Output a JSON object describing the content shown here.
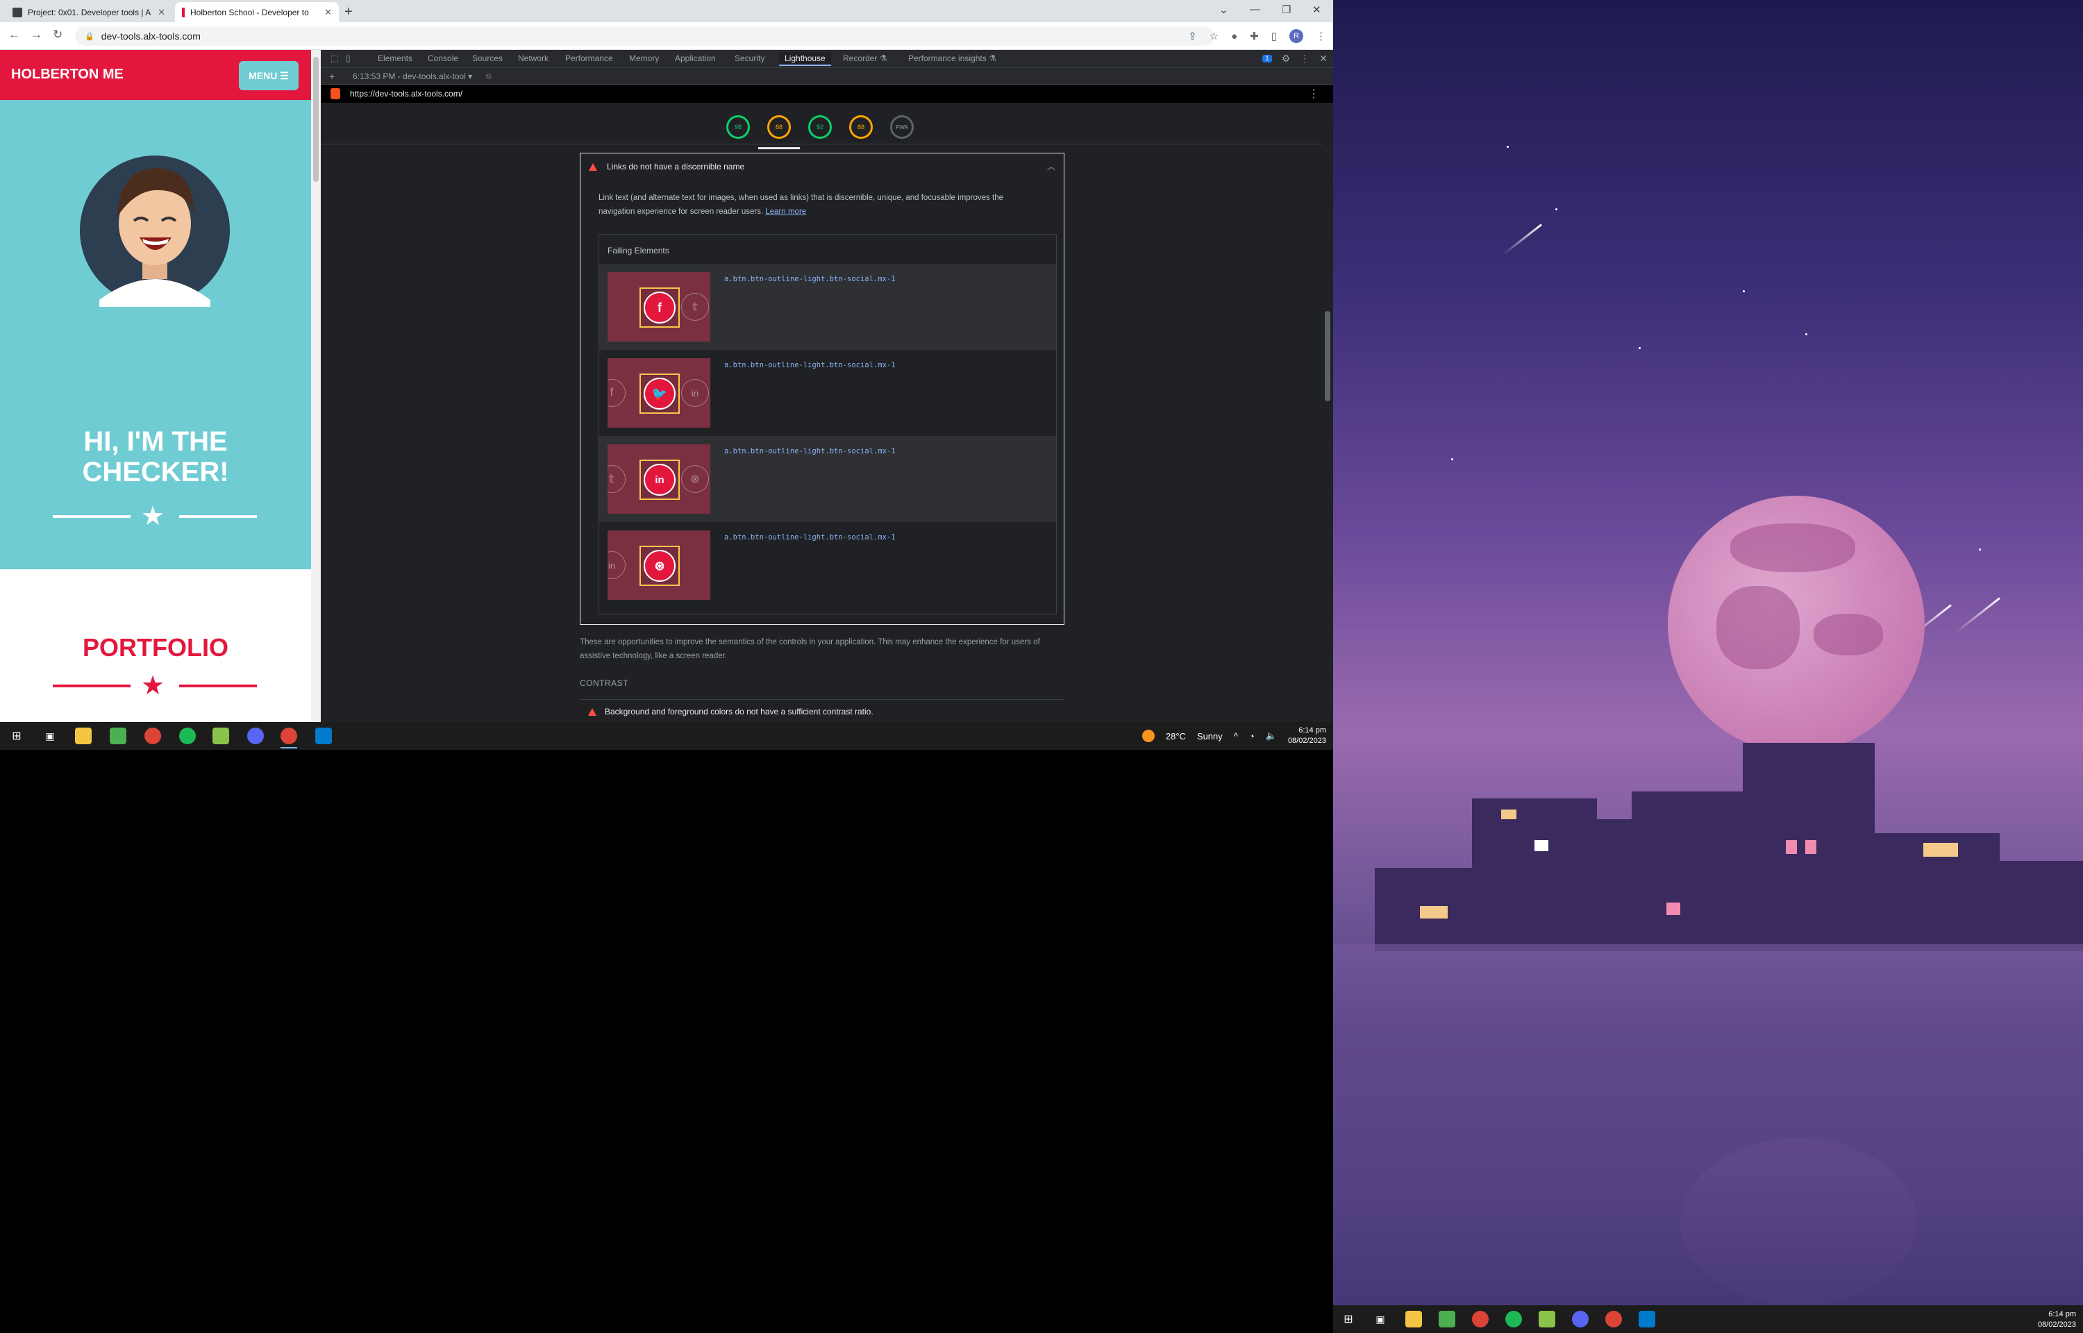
{
  "browser": {
    "tabs": [
      {
        "title": "Project: 0x01. Developer tools | A"
      },
      {
        "title": "Holberton School - Developer to"
      }
    ],
    "url": "dev-tools.alx-tools.com",
    "profile_initial": "R"
  },
  "site": {
    "logo": "HOLBERTON ME",
    "menu_label": "MENU ☰",
    "hero_title_line1": "HI, I'M THE",
    "hero_title_line2": "CHECKER!",
    "portfolio_title": "PORTFOLIO",
    "colors": {
      "primary": "#e3173e",
      "accent": "#70ccd3"
    }
  },
  "devtools": {
    "tabs": [
      "Elements",
      "Console",
      "Sources",
      "Network",
      "Performance",
      "Memory",
      "Application",
      "Security",
      "Lighthouse",
      "Recorder ⚗",
      "Performance insights ⚗"
    ],
    "active_tab": "Lighthouse",
    "issues_badge": "1",
    "report_selector": "6:13:53 PM - dev-tools.alx-tool ▾",
    "report_url": "https://dev-tools.alx-tools.com/",
    "scores": [
      {
        "value": "98",
        "color": "#0cce6b"
      },
      {
        "value": "88",
        "color": "#ffa400"
      },
      {
        "value": "92",
        "color": "#0cce6b"
      },
      {
        "value": "88",
        "color": "#ffa400"
      },
      {
        "value": "PWA",
        "color": "#9aa0a6"
      }
    ],
    "audit": {
      "title": "Links do not have a discernible name",
      "description": "Link text (and alternate text for images, when used as links) that is discernible, unique, and focusable improves the navigation experience for screen reader users.",
      "learn_more": "Learn more",
      "failing_label": "Failing Elements",
      "rows": [
        {
          "selector": "a.btn.btn-outline-light.btn-social.mx-1",
          "icon": "f"
        },
        {
          "selector": "a.btn.btn-outline-light.btn-social.mx-1",
          "icon": "🐦"
        },
        {
          "selector": "a.btn.btn-outline-light.btn-social.mx-1",
          "icon": "in"
        },
        {
          "selector": "a.btn.btn-outline-light.btn-social.mx-1",
          "icon": "⊛"
        }
      ]
    },
    "group_note": "These are opportunities to improve the semantics of the controls in your application. This may enhance the experience for users of assistive technology, like a screen reader.",
    "next_section": "CONTRAST",
    "next_audit": "Background and foreground colors do not have a sufficient contrast ratio."
  },
  "taskbar": {
    "weather_temp": "28°C",
    "weather_text": "Sunny",
    "time": "6:14 pm",
    "date": "08/02/2023"
  }
}
